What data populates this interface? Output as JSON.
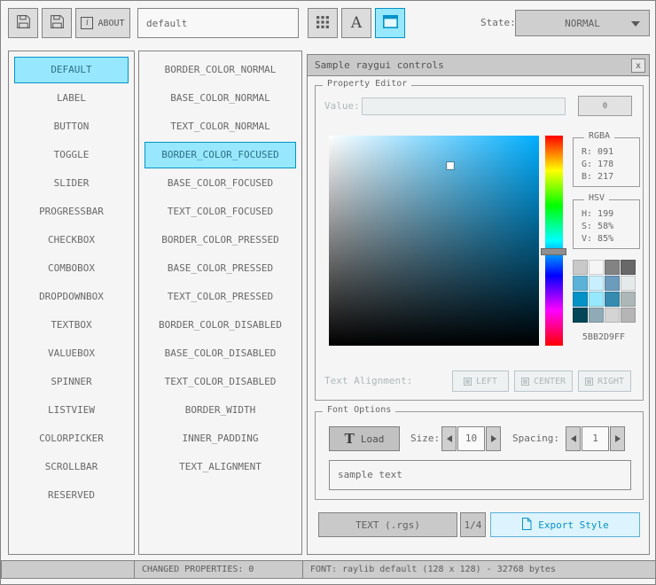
{
  "colors": {
    "accent_border": "#0492c7",
    "accent_fill": "#97e8ff",
    "focused_border": "#5bb2d9",
    "focused_fill": "#c9effe",
    "border_gray": "#838383",
    "text_gray": "#686868",
    "disabled_text": "#aeb7b8",
    "background": "#f5f5f5"
  },
  "toolbar": {
    "about_label": "ABOUT",
    "about_icon_glyph": "i",
    "style_name_value": "default",
    "font_tool_glyph": "A",
    "state_label": "State:",
    "state_value": "NORMAL"
  },
  "controls_list": [
    "DEFAULT",
    "LABEL",
    "BUTTON",
    "TOGGLE",
    "SLIDER",
    "PROGRESSBAR",
    "CHECKBOX",
    "COMBOBOX",
    "DROPDOWNBOX",
    "TEXTBOX",
    "VALUEBOX",
    "SPINNER",
    "LISTVIEW",
    "COLORPICKER",
    "SCROLLBAR",
    "RESERVED"
  ],
  "properties_list": [
    "BORDER_COLOR_NORMAL",
    "BASE_COLOR_NORMAL",
    "TEXT_COLOR_NORMAL",
    "BORDER_COLOR_FOCUSED",
    "BASE_COLOR_FOCUSED",
    "TEXT_COLOR_FOCUSED",
    "BORDER_COLOR_PRESSED",
    "BASE_COLOR_PRESSED",
    "TEXT_COLOR_PRESSED",
    "BORDER_COLOR_DISABLED",
    "BASE_COLOR_DISABLED",
    "TEXT_COLOR_DISABLED",
    "BORDER_WIDTH",
    "INNER_PADDING",
    "TEXT_ALIGNMENT"
  ],
  "sample_window": {
    "title": "Sample raygui controls",
    "close_glyph": "x",
    "property_editor": {
      "group_label": "Property Editor",
      "value_label": "Value:",
      "value_text": "",
      "value_button_label": "0",
      "rgba_label": "RGBA",
      "rgba_r": "R: 091",
      "rgba_g": "G: 178",
      "rgba_b": "B: 217",
      "hsv_label": "HSV",
      "hsv_h": "H: 199",
      "hsv_s": "S: 58%",
      "hsv_v": "V: 85%",
      "hex_value": "5BB2D9FF",
      "palette": [
        "#c9c9c9",
        "#f5f5f5",
        "#838383",
        "#686868",
        "#5bb2d9",
        "#c9effe",
        "#6c9bbc",
        "#e6e9e9",
        "#0492c7",
        "#97e8ff",
        "#368baf",
        "#aeb7b8",
        "#024658",
        "#90abb5",
        "#d4d4d4",
        "#b5b5b5"
      ],
      "text_alignment_label": "Text Alignment:",
      "align_left_label": "LEFT",
      "align_center_label": "CENTER",
      "align_right_label": "RIGHT"
    },
    "font_options": {
      "group_label": "Font Options",
      "load_icon_glyph": "T",
      "load_label": "Load",
      "size_label": "Size:",
      "size_value": "10",
      "spacing_label": "Spacing:",
      "spacing_value": "1",
      "sample_text": "sample text"
    },
    "export_bar": {
      "format_button_label": "TEXT (.rgs)",
      "page_indicator": "1/4",
      "export_button_label": "Export Style"
    }
  },
  "statusbar": {
    "left_text": "",
    "changed_properties": "CHANGED PROPERTIES: 0",
    "font_info": "FONT: raylib default (128 x 128) - 32768 bytes"
  }
}
